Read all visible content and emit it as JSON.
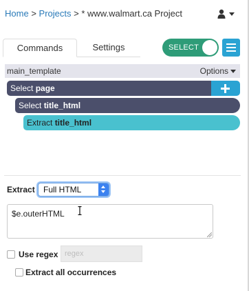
{
  "breadcrumb": {
    "home": "Home",
    "sep1": ">",
    "projects": "Projects",
    "sep2": ">",
    "current": "* www.walmart.ca Project"
  },
  "tabs": [
    {
      "label": "Commands",
      "active": true
    },
    {
      "label": "Settings",
      "active": false
    }
  ],
  "select_toggle": {
    "label": "SELECT",
    "on": true
  },
  "template": {
    "name": "main_template",
    "options_label": "Options"
  },
  "commands": [
    {
      "prefix": "Select ",
      "name": "page"
    },
    {
      "prefix": "Select ",
      "name": "title_html"
    },
    {
      "prefix": "Extract ",
      "name": "title_html"
    }
  ],
  "form": {
    "extract_label": "Extract",
    "extract_value": "Full HTML",
    "code": "$e.outerHTML",
    "use_regex_label": "Use regex",
    "use_regex_checked": false,
    "regex_placeholder": "regex",
    "extract_all_label": "Extract all occurrences",
    "extract_all_checked": false
  },
  "icons": [
    "user-icon",
    "chevron-down-icon",
    "hamburger-menu-icon",
    "plus-icon",
    "text-cursor-icon"
  ],
  "colors": {
    "link": "#2a7ab8",
    "toggle_on": "#2e9c78",
    "accent_blue": "#2aa3d3",
    "command_dark": "#4b4f6b",
    "command_active": "#49c1cf"
  }
}
